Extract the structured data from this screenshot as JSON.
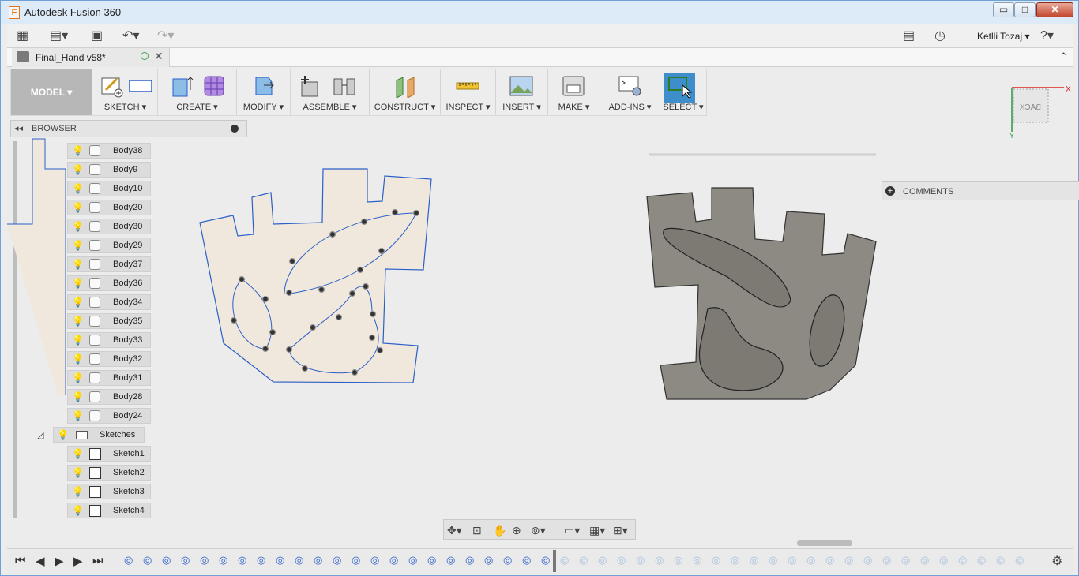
{
  "window": {
    "title": "Autodesk Fusion 360",
    "app_logo": "F",
    "min": "▭",
    "max": "□",
    "close": "✕"
  },
  "top_toolbar": {
    "user": "Ketlli Tozaj"
  },
  "document_tab": {
    "name": "Final_Hand v58*",
    "close": "✕"
  },
  "ribbon": {
    "workspace": "MODEL",
    "groups": [
      "SKETCH",
      "CREATE",
      "MODIFY",
      "ASSEMBLE",
      "CONSTRUCT",
      "INSPECT",
      "INSERT",
      "MAKE",
      "ADD-INS",
      "SELECT"
    ]
  },
  "browser": {
    "title": "BROWSER",
    "bodies": [
      "Body38",
      "Body9",
      "Body10",
      "Body20",
      "Body30",
      "Body29",
      "Body37",
      "Body36",
      "Body34",
      "Body35",
      "Body33",
      "Body32",
      "Body31",
      "Body28",
      "Body24"
    ],
    "active_body": "Body20",
    "folder": "Sketches",
    "sketches": [
      "Sketch1",
      "Sketch2",
      "Sketch3",
      "Sketch4"
    ]
  },
  "comments": {
    "title": "COMMENTS"
  },
  "viewcube": {
    "face": "BACK",
    "x_label": "X",
    "y_label": "Y"
  },
  "colors": {
    "accent": "#2b5fc9",
    "model_btn": "#b7b7b7",
    "select_active": "#3d8ecb",
    "sketch_fill": "#f0e8dc",
    "body_fill": "#8c8a83"
  }
}
